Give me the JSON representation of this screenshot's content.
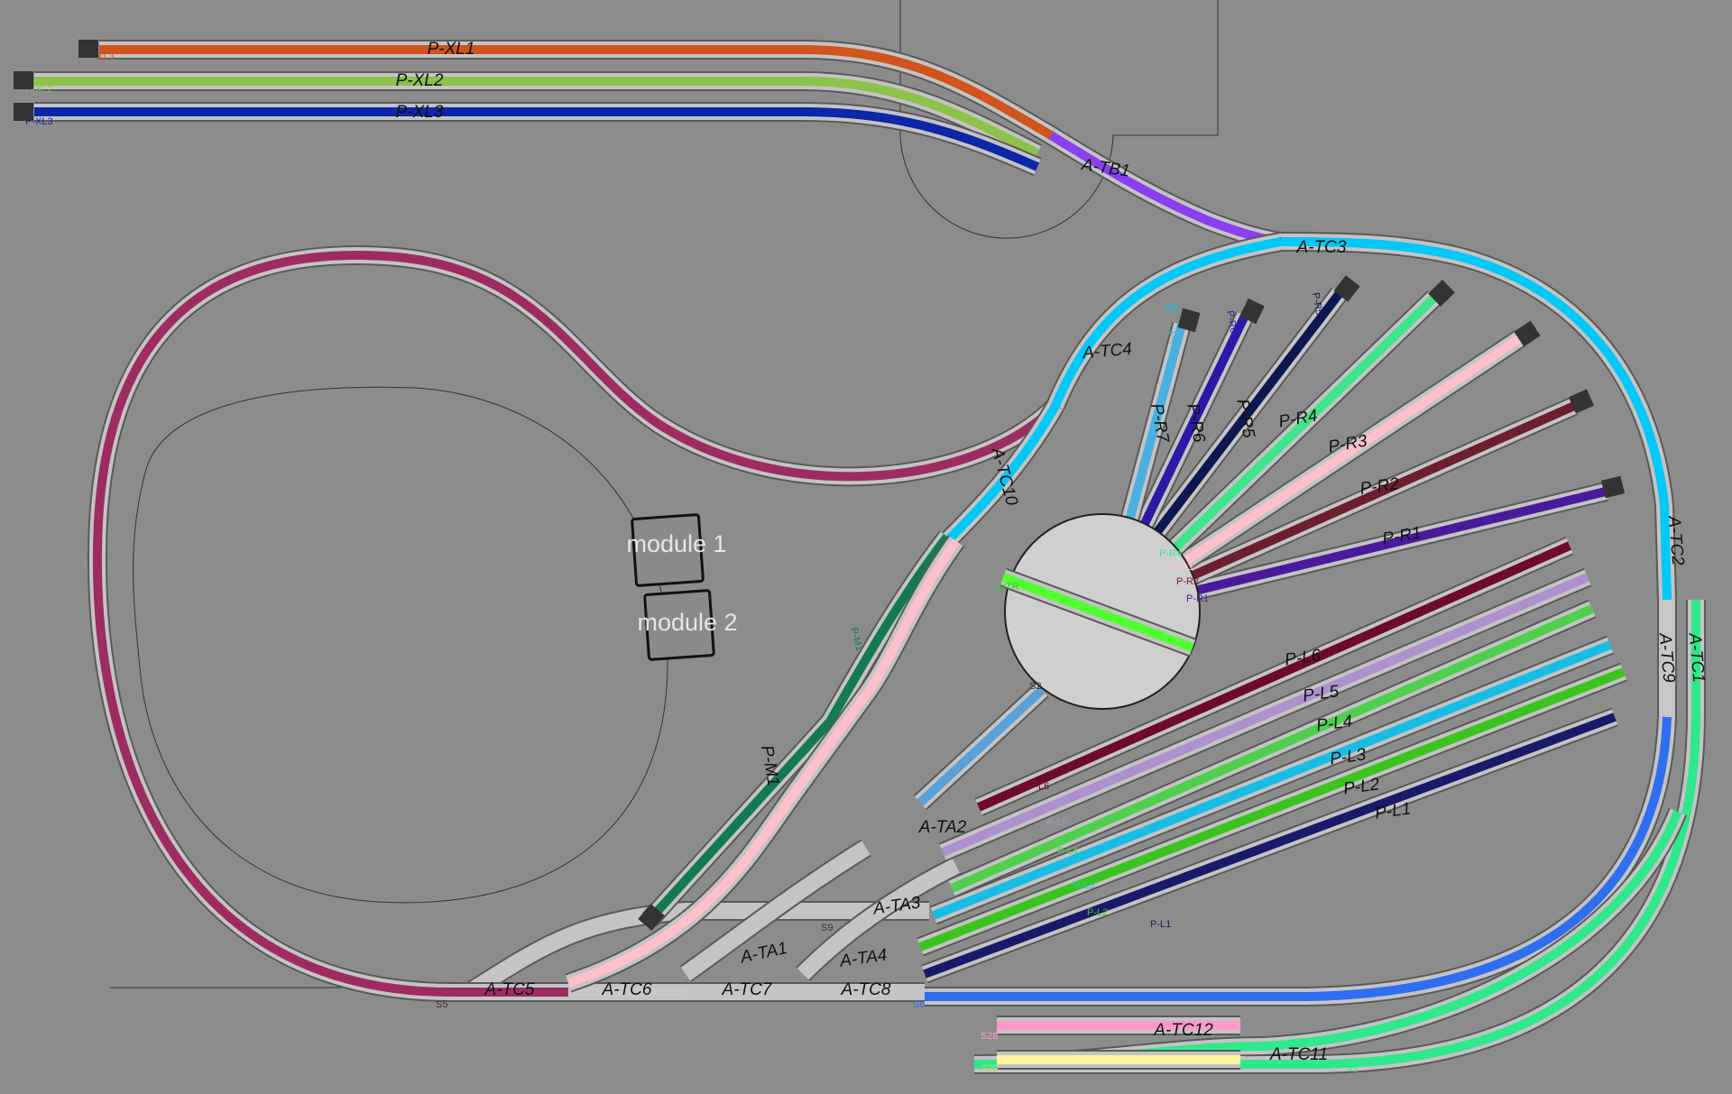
{
  "colors": {
    "background": "#8c8c8c",
    "rail": "#5a5a5a",
    "sleeper": "#c4c4c4",
    "buffer": "#333333"
  },
  "modules": [
    {
      "label": "module 1"
    },
    {
      "label": "module 2"
    }
  ],
  "sensor_labels": [
    "S5",
    "S6",
    "S9",
    "S1",
    "S2",
    "S8",
    "SrTR",
    "S2",
    "S28",
    "S29",
    "S30"
  ],
  "tracks": [
    {
      "name": "P-XL1",
      "label": "P-XL1",
      "end_label": "P-XL3",
      "color": "#d0541b"
    },
    {
      "name": "P-XL2",
      "label": "P-XL2",
      "end_label": "P-XL2",
      "color": "#8bc34a"
    },
    {
      "name": "P-XL3",
      "label": "P-XL3",
      "end_label": "P-XL3",
      "color": "#0c27a8"
    },
    {
      "name": "A-TB1",
      "label": "A-TB1",
      "color": "#8a3ff0"
    },
    {
      "name": "A-TC3",
      "label": "A-TC3",
      "color": "#00c8f8"
    },
    {
      "name": "A-TC4",
      "label": "A-TC4",
      "color": "#00c8f8"
    },
    {
      "name": "A-TC10",
      "label": "A-TC10",
      "color": "#00c8f8"
    },
    {
      "name": "A-TC2",
      "label": "A-TC2",
      "color": "#00c8f8"
    },
    {
      "name": "A-TC1",
      "label": "A-TC1",
      "color": "#2fe88a"
    },
    {
      "name": "A-TC9",
      "label": "A-TC9",
      "color": "#c8c8c8"
    },
    {
      "name": "A-TC5",
      "label": "A-TC5",
      "color": "#9e2c63"
    },
    {
      "name": "A-TC6",
      "label": "A-TC6",
      "color": "#c8c8c8"
    },
    {
      "name": "A-TC7",
      "label": "A-TC7",
      "color": "#c8c8c8"
    },
    {
      "name": "A-TC8",
      "label": "A-TC8",
      "color": "#c8c8c8"
    },
    {
      "name": "A-TC11",
      "label": "A-TC11",
      "color": "#2fe88a"
    },
    {
      "name": "A-TC12",
      "label": "A-TC12",
      "color": "#ff99cc"
    },
    {
      "name": "A-TA1",
      "label": "A-TA1",
      "color": "#c8c8c8"
    },
    {
      "name": "A-TA2",
      "label": "A-TA2",
      "color": "#5aa0d8"
    },
    {
      "name": "A-TA3",
      "label": "A-TA3",
      "color": "#c8c8c8"
    },
    {
      "name": "A-TA4",
      "label": "A-TA4",
      "color": "#c8c8c8"
    },
    {
      "name": "P-M1",
      "label": "P-M1",
      "end_label": "P-M1",
      "color": "#147a52"
    },
    {
      "name": "P-R1",
      "label": "P-R1",
      "end_label": "P-R1",
      "color": "#4b1a9c"
    },
    {
      "name": "P-R2",
      "label": "P-R2",
      "end_label": "P-R2",
      "color": "#6b1f2f"
    },
    {
      "name": "P-R3",
      "label": "P-R3",
      "end_label": "P-R3",
      "color": "#ffc0cb"
    },
    {
      "name": "P-R4",
      "label": "P-R4",
      "end_label": "P-R4",
      "color": "#3ee68a"
    },
    {
      "name": "P-R5",
      "label": "P-R5",
      "end_label": "P-R5",
      "color": "#0d1850"
    },
    {
      "name": "P-R6",
      "label": "P-R6",
      "end_label": "P-R6",
      "color": "#2a1aa6"
    },
    {
      "name": "P-R7",
      "label": "P-R7",
      "end_label": "P-R7",
      "color": "#4ab0e0"
    },
    {
      "name": "P-L6",
      "label": "P-L6",
      "end_label": "P-L6",
      "color": "#6e0a2a"
    },
    {
      "name": "P-L5",
      "label": "P-L5",
      "end_label": "P-L5",
      "color": "#b090cc"
    },
    {
      "name": "P-L4",
      "label": "P-L4",
      "end_label": "P-L4",
      "color": "#4ed04e"
    },
    {
      "name": "P-L3",
      "label": "P-L3",
      "end_label": "P-L3",
      "color": "#18bde6"
    },
    {
      "name": "P-L2",
      "label": "P-L2",
      "end_label": "P-L2",
      "color": "#3cc41e"
    },
    {
      "name": "P-L1",
      "label": "P-L1",
      "end_label": "P-L1",
      "color": "#1a1a6a"
    },
    {
      "name": "turntable",
      "label": "SrTR",
      "color": "#50ff30"
    },
    {
      "name": "loop-left",
      "color": "#9e2c63"
    },
    {
      "name": "right-loop-blue",
      "color": "#2f6ef0"
    },
    {
      "name": "right-loop-green",
      "color": "#2fe88a"
    }
  ]
}
